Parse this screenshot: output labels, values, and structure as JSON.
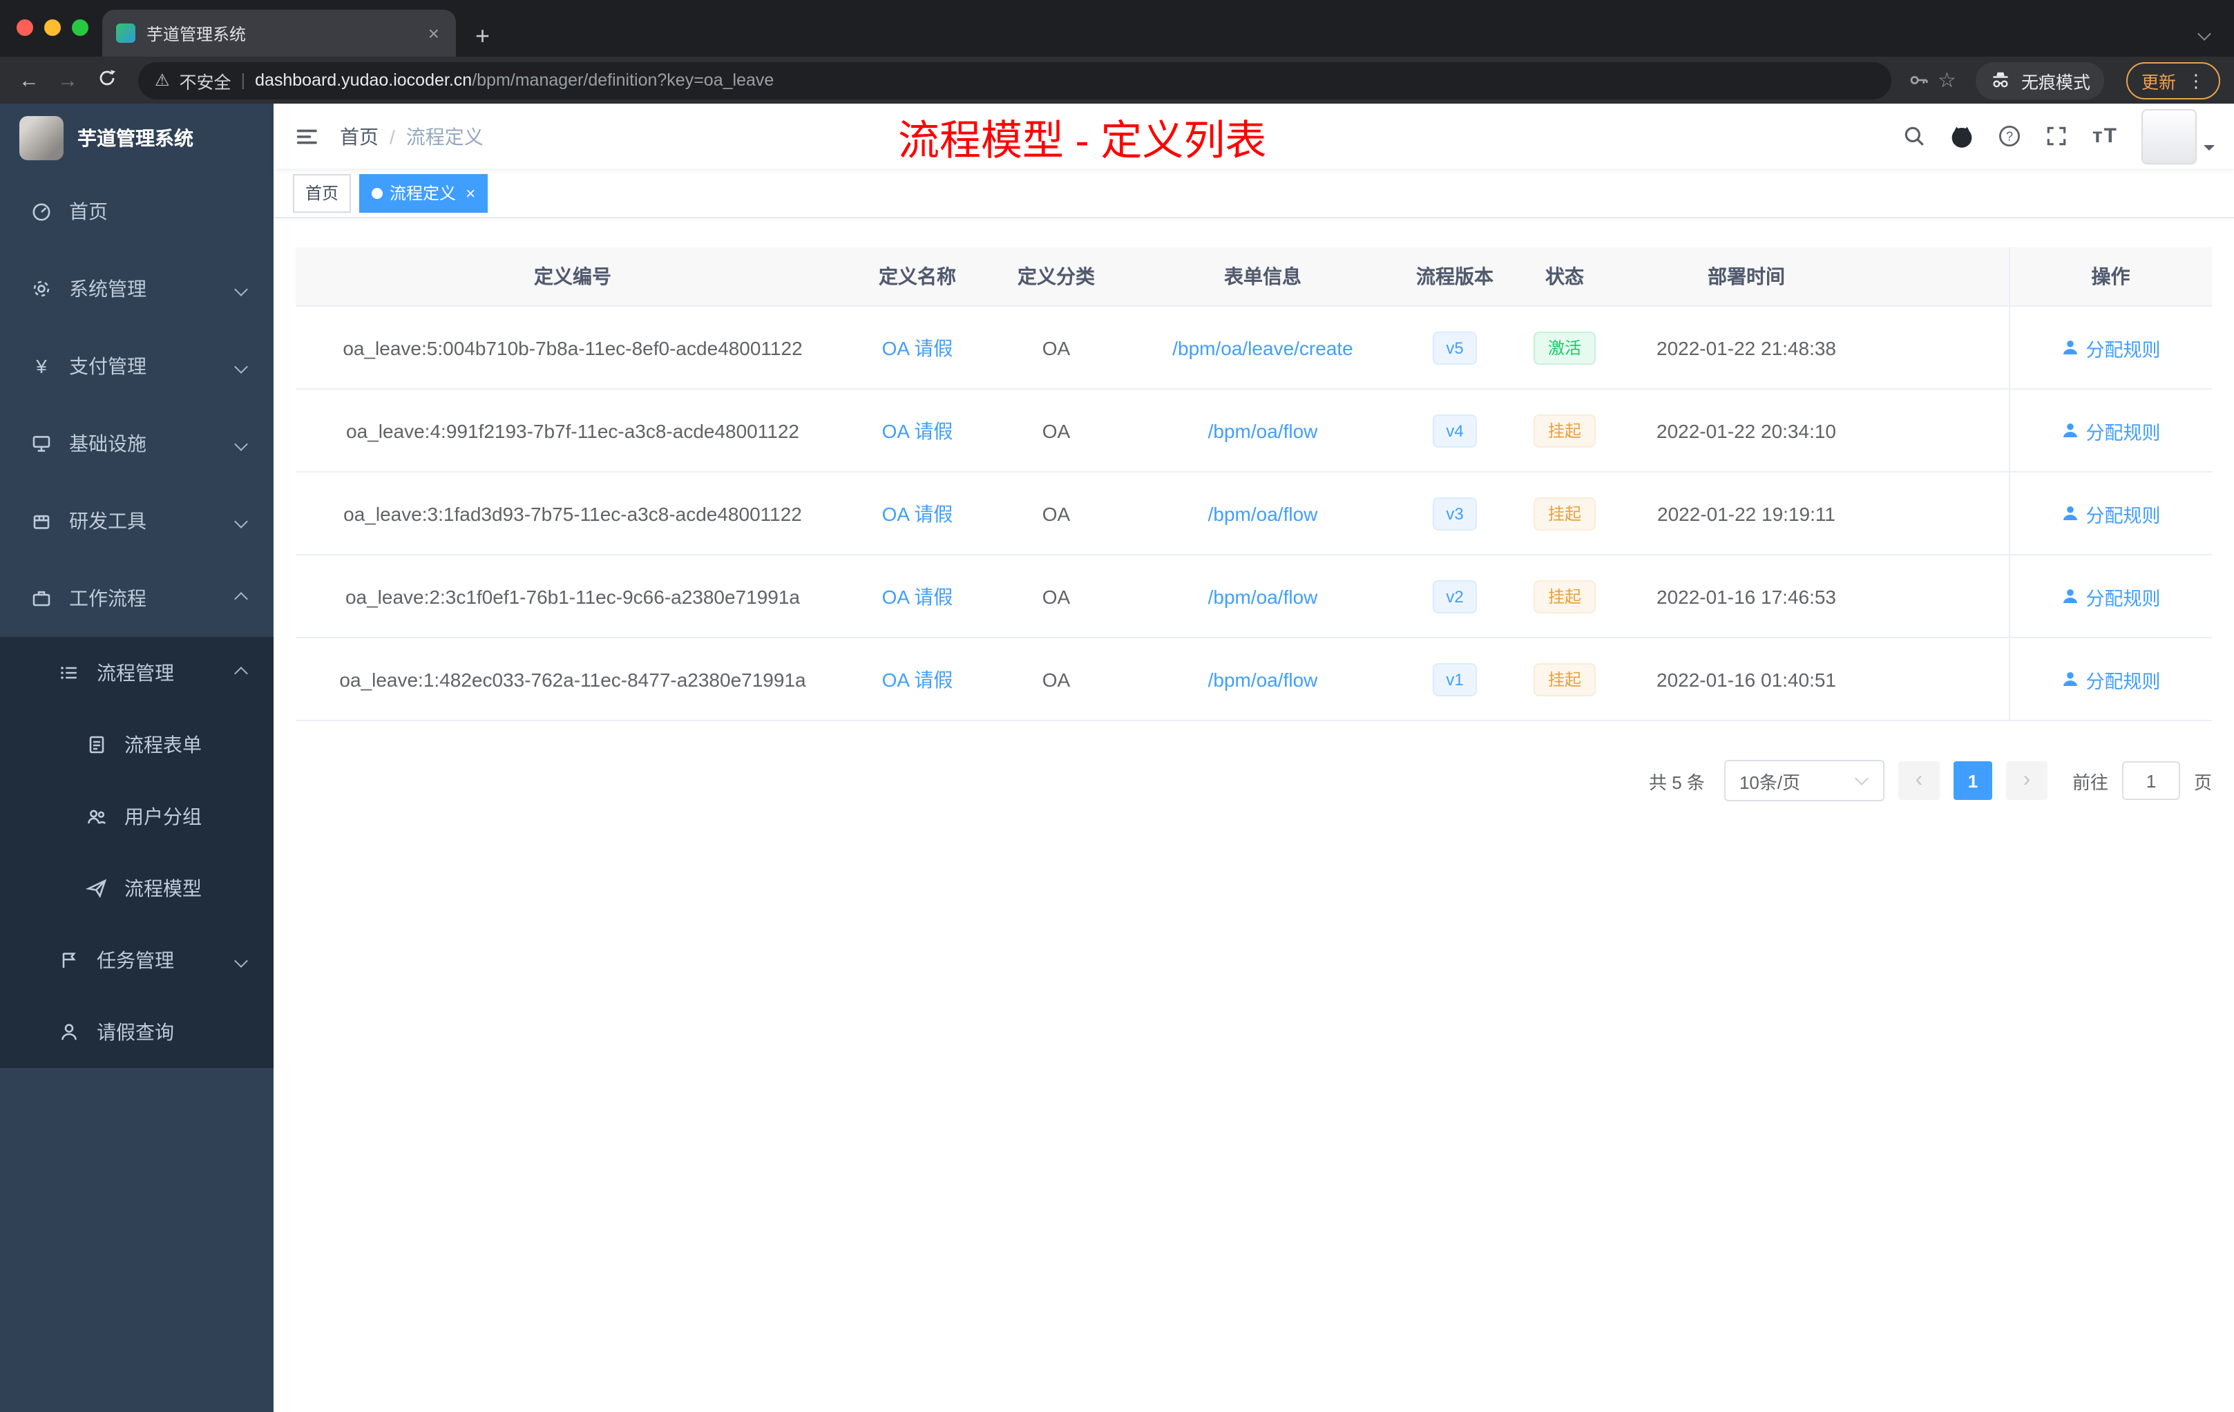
{
  "browser": {
    "tab_title": "芋道管理系统",
    "new_tab": "+",
    "close": "×",
    "not_secure": "不安全",
    "url_host": "dashboard.yudao.iocoder.cn",
    "url_path": "/bpm/manager/definition?key=oa_leave",
    "incognito": "无痕模式",
    "update": "更新"
  },
  "sidebar": {
    "logo_title": "芋道管理系统",
    "menu": [
      {
        "label": "首页"
      },
      {
        "label": "系统管理"
      },
      {
        "label": "支付管理"
      },
      {
        "label": "基础设施"
      },
      {
        "label": "研发工具"
      },
      {
        "label": "工作流程"
      }
    ],
    "submenu": [
      {
        "label": "流程管理"
      },
      {
        "label": "流程表单"
      },
      {
        "label": "用户分组"
      },
      {
        "label": "流程模型"
      },
      {
        "label": "任务管理"
      },
      {
        "label": "请假查询"
      }
    ]
  },
  "header": {
    "breadcrumb_home": "首页",
    "breadcrumb_sep": "/",
    "breadcrumb_current": "流程定义",
    "annotation": "流程模型 - 定义列表",
    "fontsize_icon": "тT"
  },
  "tags": {
    "home": "首页",
    "current": "流程定义",
    "close": "×"
  },
  "table": {
    "columns": [
      "定义编号",
      "定义名称",
      "定义分类",
      "表单信息",
      "流程版本",
      "状态",
      "部署时间",
      "操作"
    ],
    "rows": [
      {
        "id": "oa_leave:5:004b710b-7b8a-11ec-8ef0-acde48001122",
        "name": "OA 请假",
        "category": "OA",
        "form": "/bpm/oa/leave/create",
        "version": "v5",
        "status": "激活",
        "time": "2022-01-22 21:48:38",
        "action": "分配规则"
      },
      {
        "id": "oa_leave:4:991f2193-7b7f-11ec-a3c8-acde48001122",
        "name": "OA 请假",
        "category": "OA",
        "form": "/bpm/oa/flow",
        "version": "v4",
        "status": "挂起",
        "time": "2022-01-22 20:34:10",
        "action": "分配规则"
      },
      {
        "id": "oa_leave:3:1fad3d93-7b75-11ec-a3c8-acde48001122",
        "name": "OA 请假",
        "category": "OA",
        "form": "/bpm/oa/flow",
        "version": "v3",
        "status": "挂起",
        "time": "2022-01-22 19:19:11",
        "action": "分配规则"
      },
      {
        "id": "oa_leave:2:3c1f0ef1-76b1-11ec-9c66-a2380e71991a",
        "name": "OA 请假",
        "category": "OA",
        "form": "/bpm/oa/flow",
        "version": "v2",
        "status": "挂起",
        "time": "2022-01-16 17:46:53",
        "action": "分配规则"
      },
      {
        "id": "oa_leave:1:482ec033-762a-11ec-8477-a2380e71991a",
        "name": "OA 请假",
        "category": "OA",
        "form": "/bpm/oa/flow",
        "version": "v1",
        "status": "挂起",
        "time": "2022-01-16 01:40:51",
        "action": "分配规则"
      }
    ]
  },
  "pagination": {
    "total": "共 5 条",
    "page_size": "10条/页",
    "prev": "‹",
    "next": "›",
    "page": "1",
    "goto": "前往",
    "goto_value": "1",
    "unit": "页"
  },
  "colors": {
    "accent": "#409eff",
    "success": "#13ce66",
    "warning": "#e6a23c",
    "annotation": "#fe0000",
    "sidebar": "#304156",
    "sidebar_sub": "#1f2d3d"
  }
}
